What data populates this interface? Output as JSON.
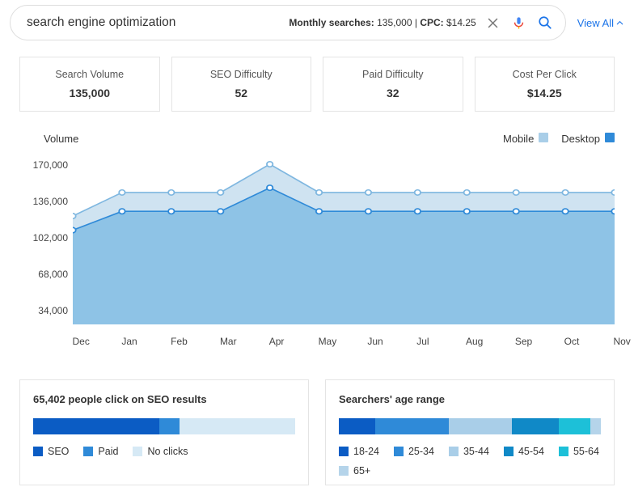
{
  "search": {
    "query": "search engine optimization",
    "meta_prefix": "Monthly searches:",
    "meta_searches": "135,000",
    "meta_cpc_label": "CPC:",
    "meta_cpc": "$14.25"
  },
  "viewall_label": "View All",
  "tiles": [
    {
      "label": "Search Volume",
      "value": "135,000"
    },
    {
      "label": "SEO Difficulty",
      "value": "52"
    },
    {
      "label": "Paid Difficulty",
      "value": "32"
    },
    {
      "label": "Cost Per Click",
      "value": "$14.25"
    }
  ],
  "chart_head": {
    "title": "Volume",
    "legend": [
      {
        "label": "Mobile",
        "color": "#a9cee8"
      },
      {
        "label": "Desktop",
        "color": "#2f8ad8"
      }
    ]
  },
  "chart_data": {
    "type": "area",
    "title": "Volume",
    "xlabel": "",
    "ylabel": "",
    "ylim": [
      0,
      170000
    ],
    "yticks": [
      170000,
      136000,
      102000,
      68000,
      34000
    ],
    "ytick_labels": [
      "170,000",
      "136,000",
      "102,000",
      "68,000",
      "34,000"
    ],
    "categories": [
      "Dec",
      "Jan",
      "Feb",
      "Mar",
      "Apr",
      "May",
      "Jun",
      "Jul",
      "Aug",
      "Sep",
      "Oct",
      "Nov"
    ],
    "series": [
      {
        "name": "Mobile+Desktop (top)",
        "color_fill": "#cfe3f1",
        "color_line": "#7fb7e0",
        "values": [
          115000,
          140000,
          140000,
          140000,
          170000,
          140000,
          140000,
          140000,
          140000,
          140000,
          140000,
          140000
        ]
      },
      {
        "name": "Desktop (bottom)",
        "color_fill": "#8ec3e6",
        "color_line": "#2f8ad8",
        "values": [
          100000,
          120000,
          120000,
          120000,
          145000,
          120000,
          120000,
          120000,
          120000,
          120000,
          120000,
          120000
        ]
      }
    ],
    "legend": [
      "Mobile",
      "Desktop"
    ]
  },
  "bottom": {
    "left": {
      "title": "65,402 people click on SEO results",
      "segments": [
        {
          "label": "SEO",
          "color": "#0b5cc4",
          "pct": 48
        },
        {
          "label": "Paid",
          "color": "#2f8ad8",
          "pct": 8
        },
        {
          "label": "No clicks",
          "color": "#d6e9f5",
          "pct": 44
        }
      ]
    },
    "right": {
      "title": "Searchers' age range",
      "segments": [
        {
          "label": "18-24",
          "color": "#0b5cc4",
          "pct": 14
        },
        {
          "label": "25-34",
          "color": "#2f8ad8",
          "pct": 28
        },
        {
          "label": "35-44",
          "color": "#a9cee8",
          "pct": 24
        },
        {
          "label": "45-54",
          "color": "#1089c7",
          "pct": 18
        },
        {
          "label": "55-64",
          "color": "#1dc0d8",
          "pct": 12
        },
        {
          "label": "65+",
          "color": "#b5d4ea",
          "pct": 4
        }
      ]
    }
  }
}
